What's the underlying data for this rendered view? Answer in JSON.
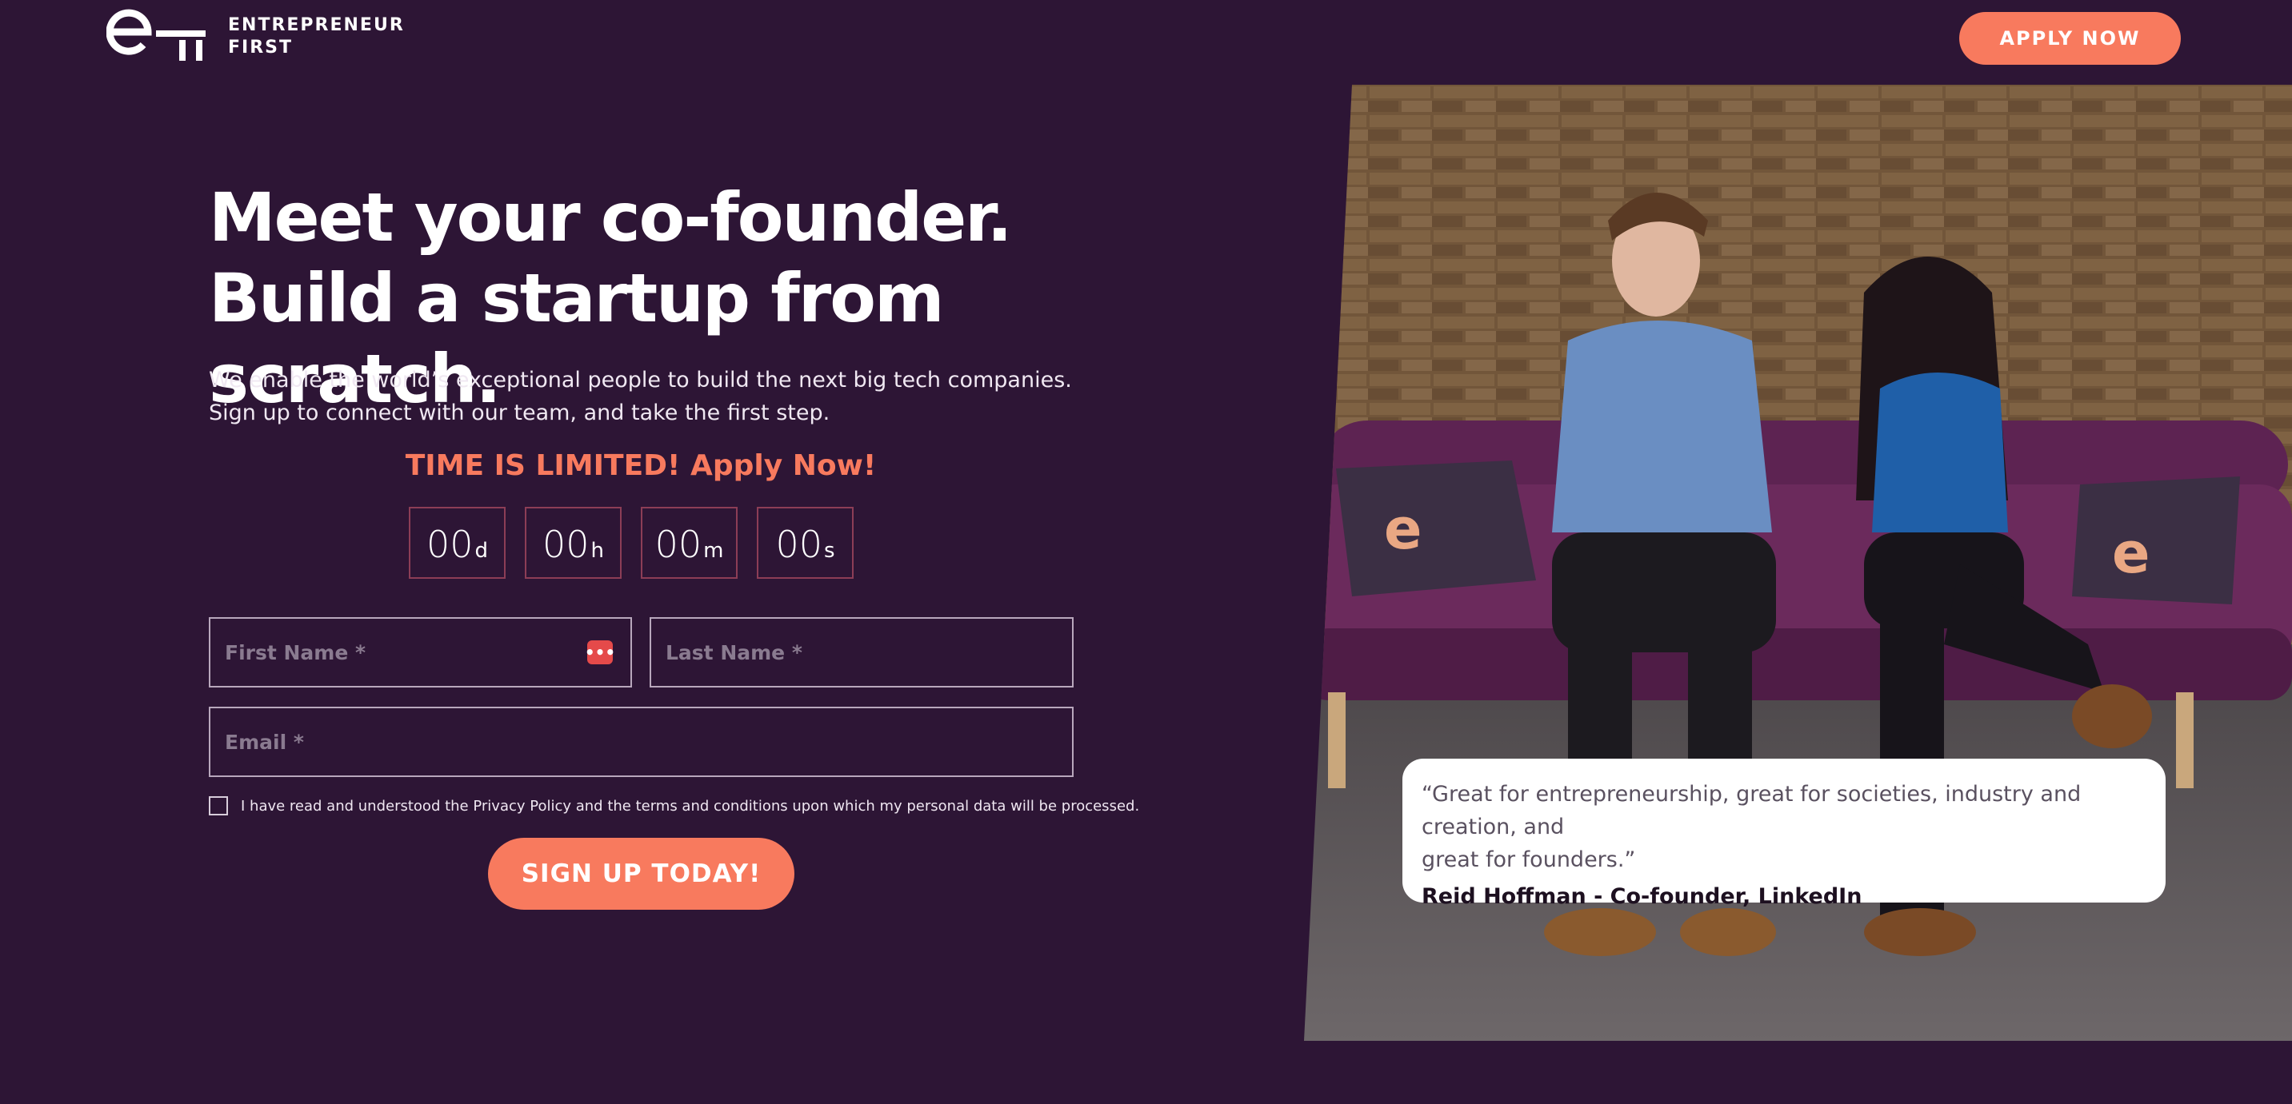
{
  "brand": {
    "name_line1": "ENTREPRENEUR",
    "name_line2": "FIRST",
    "logo_icon": "ef-logo-icon"
  },
  "header": {
    "apply_label": "APPLY NOW"
  },
  "hero": {
    "headline_line1": "Meet your co-founder.",
    "headline_line2": "Build a startup from scratch.",
    "subtext_line1": "We enable the world’s exceptional people to build the next big tech companies.",
    "subtext_line2": "Sign up to connect with our team, and take the first step."
  },
  "countdown": {
    "heading": "TIME IS LIMITED! Apply Now!",
    "days": "00",
    "days_unit": "d",
    "hours": "00",
    "hours_unit": "h",
    "minutes": "00",
    "minutes_unit": "m",
    "seconds": "00",
    "seconds_unit": "s"
  },
  "form": {
    "first_name_placeholder": "First Name *",
    "last_name_placeholder": "Last Name *",
    "email_placeholder": "Email *",
    "consent_text": "I have read and understood the Privacy Policy and the terms and conditions upon which my personal data will be processed.",
    "submit_label": "SIGN UP TODAY!",
    "password_manager_icon": "password-manager-icon"
  },
  "testimonial": {
    "quote_line1": "“Great for entrepreneurship, great for societies, industry and creation, and",
    "quote_line2": "great for founders.”",
    "author": "Reid Hoffman - Co-founder, LinkedIn"
  },
  "colors": {
    "background": "#2d1535",
    "accent": "#f87a5e",
    "countdown_border": "#8c3d56",
    "sofa": "#6b2a5c"
  }
}
